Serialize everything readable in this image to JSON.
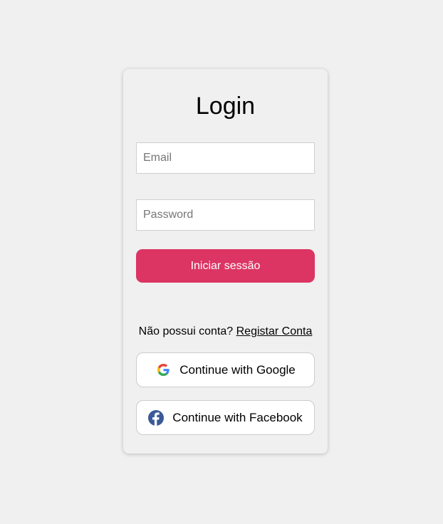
{
  "login": {
    "title": "Login",
    "email_placeholder": "Email",
    "password_placeholder": "Password",
    "submit_label": "Iniciar sessão",
    "no_account_text": "Não possui conta?",
    "register_link": "Registar Conta"
  },
  "social": {
    "google_label": "Continue with Google",
    "google_icon": "google-g-icon",
    "facebook_label": "Continue with Facebook",
    "facebook_icon": "facebook-icon"
  },
  "colors": {
    "background": "#f0f0f0",
    "submit_button": "#dc3563",
    "facebook_blue": "#3b5998"
  }
}
